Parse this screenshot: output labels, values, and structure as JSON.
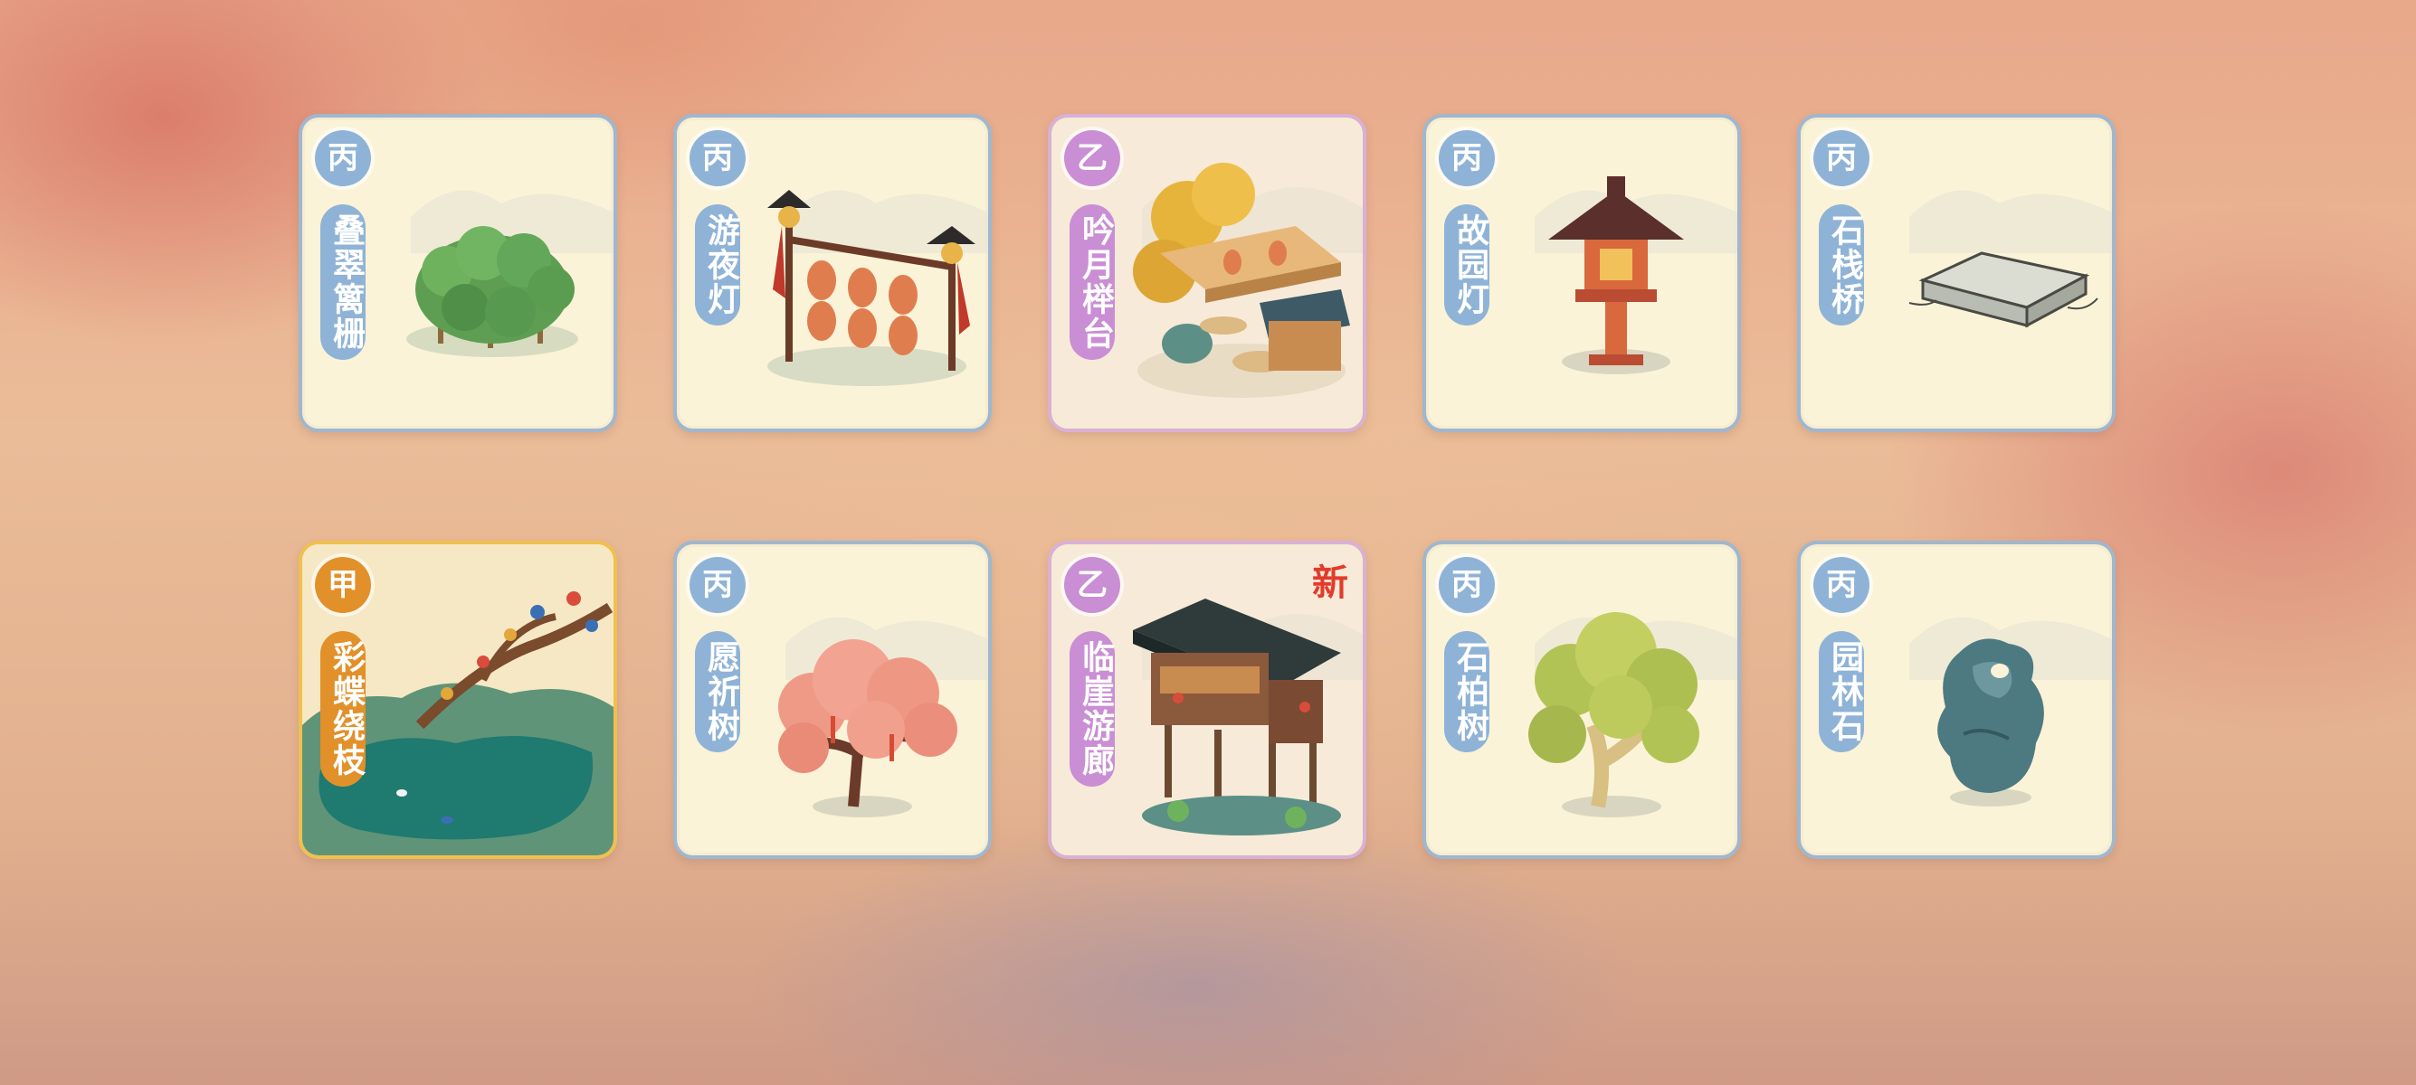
{
  "items": [
    {
      "tier": "丙",
      "name": "叠翠篱栅",
      "icon": "hedge-fence-icon"
    },
    {
      "tier": "丙",
      "name": "游夜灯",
      "icon": "night-lantern-rack-icon"
    },
    {
      "tier": "乙",
      "name": "吟月榉台",
      "icon": "moon-terrace-icon"
    },
    {
      "tier": "丙",
      "name": "故园灯",
      "icon": "stone-lantern-icon"
    },
    {
      "tier": "丙",
      "name": "石栈桥",
      "icon": "stone-bridge-icon"
    },
    {
      "tier": "甲",
      "name": "彩蝶绕枝",
      "icon": "butterfly-branch-pond-icon"
    },
    {
      "tier": "丙",
      "name": "愿祈树",
      "icon": "wishing-tree-icon"
    },
    {
      "tier": "乙",
      "name": "临崖游廊",
      "icon": "cliff-corridor-icon",
      "new": "新"
    },
    {
      "tier": "丙",
      "name": "石柏树",
      "icon": "cypress-tree-icon"
    },
    {
      "tier": "丙",
      "name": "园林石",
      "icon": "garden-rock-icon"
    }
  ],
  "colors": {
    "tier_c": "#8fb3d6",
    "tier_b": "#c98ed3",
    "tier_a": "#e2902a",
    "new_tag": "#e23b2b"
  }
}
